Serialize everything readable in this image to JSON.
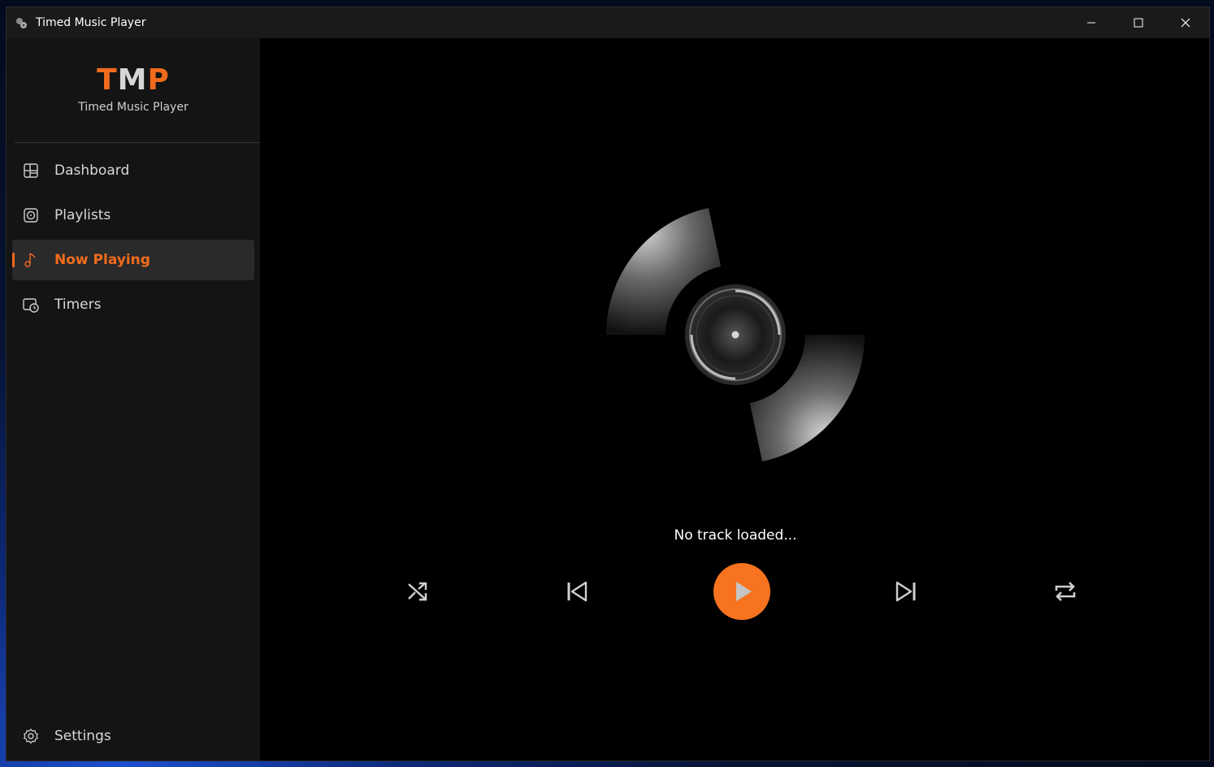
{
  "window": {
    "title": "Timed Music Player",
    "controls": [
      "minimize",
      "maximize",
      "close"
    ]
  },
  "sidebar": {
    "brand": {
      "logo_t": "T",
      "logo_m": "M",
      "logo_p": "P",
      "subtitle": "Timed Music Player"
    },
    "items": [
      {
        "label": "Dashboard",
        "icon": "dashboard-icon",
        "active": false
      },
      {
        "label": "Playlists",
        "icon": "playlist-icon",
        "active": false
      },
      {
        "label": "Now Playing",
        "icon": "music-note-icon",
        "active": true
      },
      {
        "label": "Timers",
        "icon": "timer-icon",
        "active": false
      }
    ],
    "settings_label": "Settings"
  },
  "player": {
    "track_status": "No track loaded...",
    "controls": [
      "shuffle",
      "previous",
      "play",
      "next",
      "repeat"
    ]
  },
  "colors": {
    "accent": "#f26b1d",
    "background": "#000000",
    "sidebar": "#141414"
  }
}
